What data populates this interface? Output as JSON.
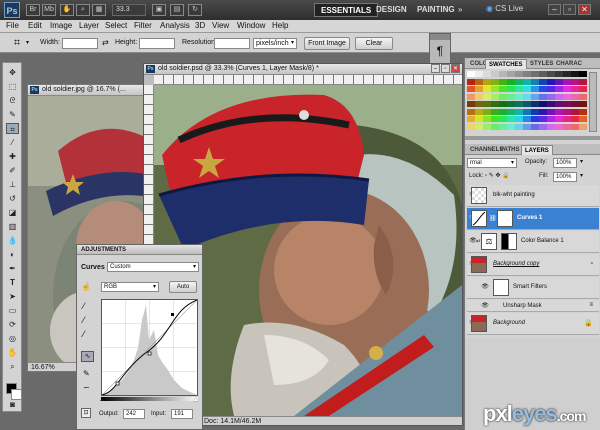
{
  "app": {
    "logo": "Ps",
    "zoom": "33.3",
    "workspaces": [
      "ESSENTIALS",
      "DESIGN",
      "PAINTING"
    ],
    "cs_live": "CS Live"
  },
  "menu": [
    "File",
    "Edit",
    "Image",
    "Layer",
    "Select",
    "Filter",
    "Analysis",
    "3D",
    "View",
    "Window",
    "Help"
  ],
  "options": {
    "width_label": "Width:",
    "height_label": "Height:",
    "resolution_label": "Resolution:",
    "resolution_unit": "pixels/inch",
    "front_image": "Front Image",
    "clear": "Clear"
  },
  "doc_small": {
    "title": "old soldier.jpg @ 16.7% (...",
    "zoom": "16.67%"
  },
  "doc_main": {
    "title": "old soldier.psd @ 33.3% (Curves 1, Layer Mask/8) *",
    "status": "Doc: 14.1M/46.2M"
  },
  "panels": {
    "top_tabs": [
      "COLOR",
      "SWATCHES",
      "STYLES",
      "CHARAC"
    ],
    "layer_tabs": [
      "CHANNELS",
      "PATHS",
      "LAYERS"
    ],
    "blend_mode": "rmal",
    "opacity_label": "Opacity:",
    "opacity": "100%",
    "fill_label": "Fill:",
    "fill": "100%",
    "layers": [
      {
        "name": "blk-wht painting"
      },
      {
        "name": "Curves 1"
      },
      {
        "name": "Color Balance 1"
      },
      {
        "name": "Background copy"
      },
      {
        "name": "Smart Filters"
      },
      {
        "name": "Unsharp Mask"
      },
      {
        "name": "Background"
      }
    ]
  },
  "adjustments": {
    "title": "ADJUSTMENTS",
    "curves_label": "Curves",
    "preset": "Custom",
    "channel": "RGB",
    "auto": "Auto",
    "output_label": "Output:",
    "output": "242",
    "input_label": "Input:",
    "input": "191"
  },
  "paragraph_icon": "¶",
  "watermark": {
    "main": "pxl",
    "accent": "eyes",
    "suffix": ".com"
  },
  "colors": {
    "selected_layer": "#3a82d1",
    "cap_red": "#c8242a",
    "cap_navy": "#1e2e6a"
  }
}
